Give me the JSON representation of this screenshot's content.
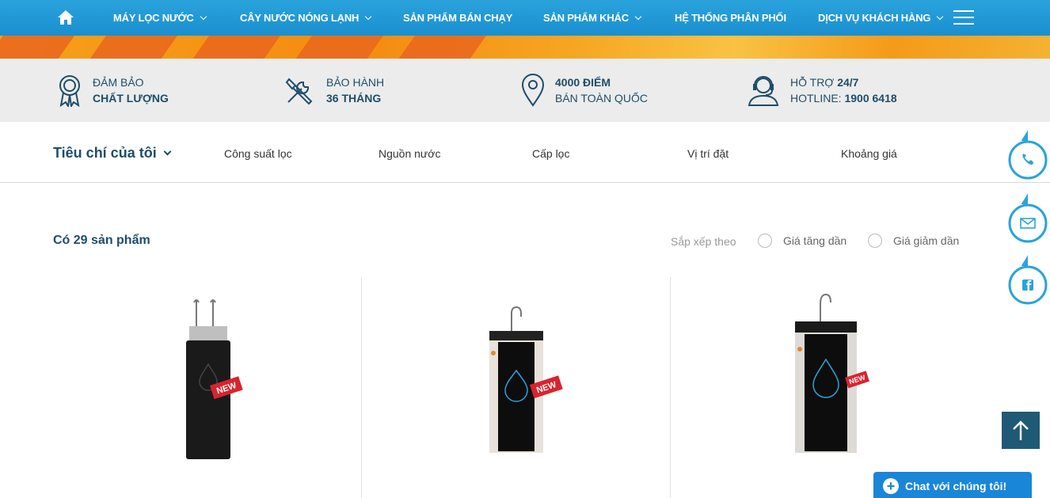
{
  "nav": {
    "items": [
      {
        "label": "MÁY LỌC NƯỚC",
        "dropdown": true
      },
      {
        "label": "CÂY NƯỚC NÓNG LẠNH",
        "dropdown": true
      },
      {
        "label": "SẢN PHẨM BÁN CHẠY",
        "dropdown": false
      },
      {
        "label": "SẢN PHẨM KHÁC",
        "dropdown": true
      },
      {
        "label": "HỆ THỐNG PHÂN PHỐI",
        "dropdown": false
      },
      {
        "label": "DỊCH VỤ KHÁCH HÀNG",
        "dropdown": true
      }
    ]
  },
  "features": [
    {
      "line1": "ĐẢM BẢO",
      "line2": "CHẤT LƯỢNG",
      "icon": "medal-icon"
    },
    {
      "line1": "BẢO HÀNH",
      "line2": "36 THÁNG",
      "icon": "tools-icon"
    },
    {
      "line1": "4000 ĐIỂM",
      "line2": "BÁN TOÀN QUỐC",
      "icon": "location-pin-icon"
    },
    {
      "line1": "HỖ TRỢ ",
      "line1_bold": "24/7",
      "line2": "HOTLINE: ",
      "line2_bold": "1900 6418",
      "icon": "support-agent-icon"
    }
  ],
  "filters": {
    "criteria_label": "Tiêu chí của tôi",
    "options": [
      "Công suất lọc",
      "Nguồn nước",
      "Cấp lọc",
      "Vị trí đặt",
      "Khoảng giá"
    ]
  },
  "listing": {
    "count_text": "Có 29 sản phẩm",
    "sort_label": "Sắp xếp theo",
    "sort_options": [
      "Giá tăng dần",
      "Giá giảm dần"
    ]
  },
  "products": [
    {
      "badge": "NEW",
      "name": ""
    },
    {
      "badge": "NEW",
      "name": ""
    },
    {
      "badge": "NEW",
      "name": ""
    }
  ],
  "chat": {
    "label": "Chat với chúng tôi!"
  },
  "colors": {
    "nav": "#1a8fd0",
    "text_dark": "#1e4d6b",
    "badge": "#d9232e",
    "chat": "#1a86d8",
    "totop": "#1e5a75"
  }
}
